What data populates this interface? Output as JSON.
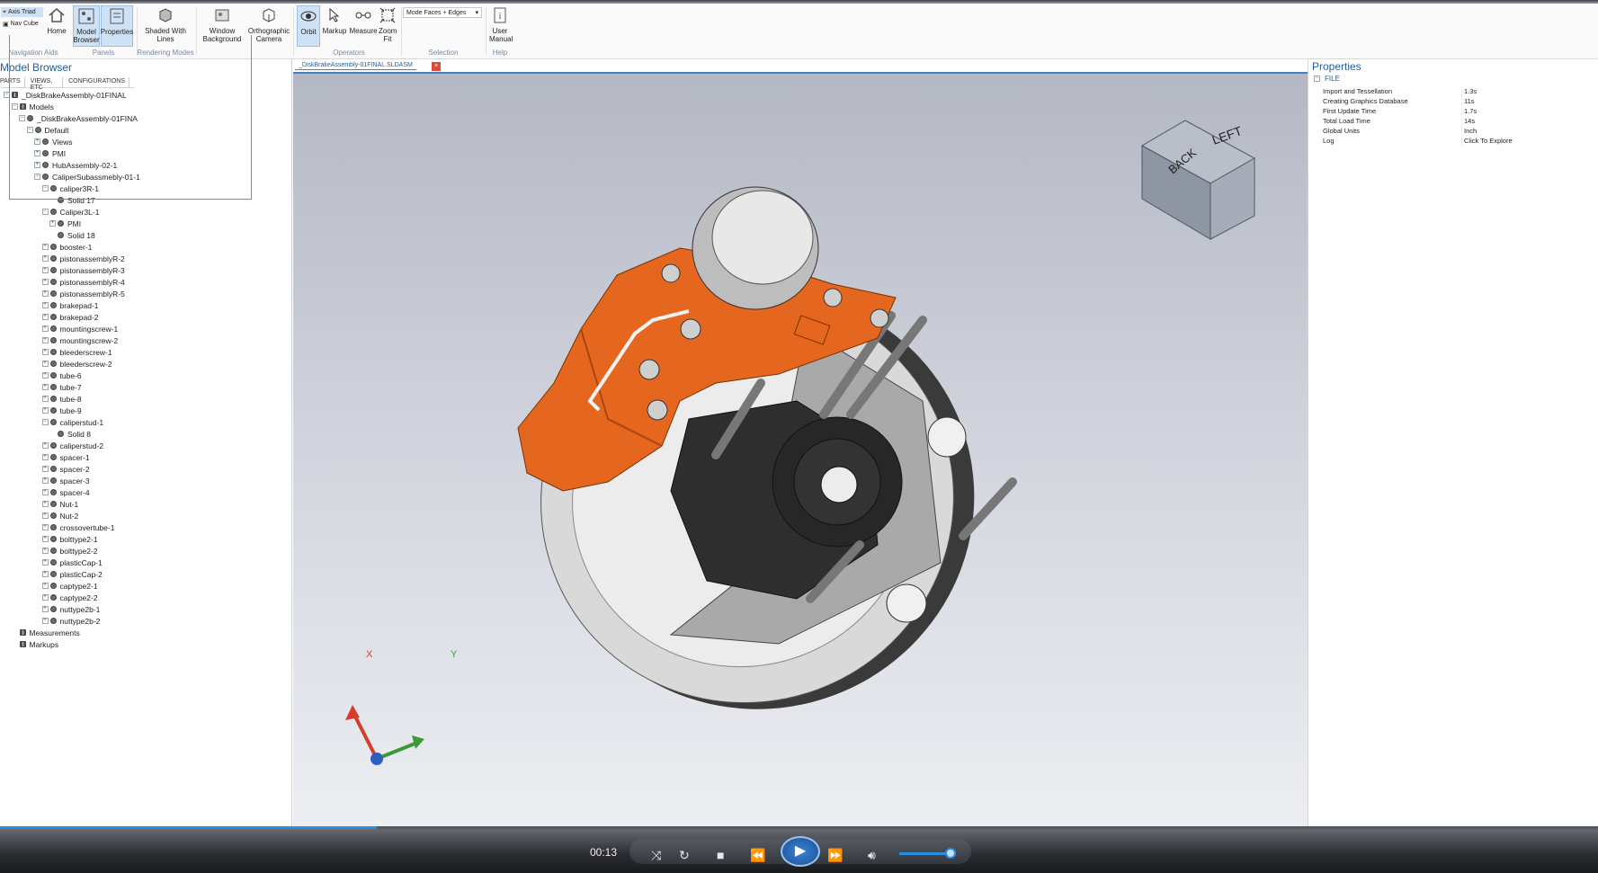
{
  "ribbon": {
    "axis_triad": "Axis Triad",
    "nav_cube": "Nav Cube",
    "home": "Home",
    "model_browser": "Model Browser",
    "properties": "Properties",
    "shaded_with_lines": "Shaded With Lines",
    "window_background": "Window Background",
    "orthographic_camera": "Orthographic Camera",
    "orbit": "Orbit",
    "markup": "Markup",
    "measure": "Measure",
    "zoom_fit": "Zoom Fit",
    "mode_dropdown": "Mode Faces + Edges",
    "user_manual": "User Manual",
    "groups": {
      "navigation_aids": "Navigation Aids",
      "panels": "Panels",
      "rendering_modes": "Rendering Modes",
      "operators": "Operators",
      "selection": "Selection",
      "help": "Help"
    }
  },
  "model_browser": {
    "title": "Model Browser",
    "tabs": [
      "PARTS",
      "VIEWS, ETC",
      "CONFIGURATIONS"
    ],
    "tree": [
      {
        "label": "_DiskBrakeAssembly-01FINAL",
        "depth": 0,
        "exp": "-"
      },
      {
        "label": "Models",
        "depth": 1,
        "exp": "-"
      },
      {
        "label": "_DiskBrakeAssembly-01FINA",
        "depth": 2,
        "exp": "-"
      },
      {
        "label": "Default",
        "depth": 3,
        "exp": "-"
      },
      {
        "label": "Views",
        "depth": 4,
        "exp": "+"
      },
      {
        "label": "PMI",
        "depth": 4,
        "exp": "+"
      },
      {
        "label": "HubAssembly-02-1",
        "depth": 4,
        "exp": "+"
      },
      {
        "label": "CaliperSubassmebly-01-1",
        "depth": 4,
        "exp": "-"
      },
      {
        "label": "caliper3R-1",
        "depth": 5,
        "exp": "-"
      },
      {
        "label": "Solid 17",
        "depth": 6,
        "exp": ""
      },
      {
        "label": "Caliper3L-1",
        "depth": 5,
        "exp": "-"
      },
      {
        "label": "PMI",
        "depth": 6,
        "exp": "+"
      },
      {
        "label": "Solid 18",
        "depth": 6,
        "exp": ""
      },
      {
        "label": "booster-1",
        "depth": 5,
        "exp": "+"
      },
      {
        "label": "pistonassemblyR-2",
        "depth": 5,
        "exp": "+"
      },
      {
        "label": "pistonassemblyR-3",
        "depth": 5,
        "exp": "+"
      },
      {
        "label": "pistonassemblyR-4",
        "depth": 5,
        "exp": "+"
      },
      {
        "label": "pistonassemblyR-5",
        "depth": 5,
        "exp": "+"
      },
      {
        "label": "brakepad-1",
        "depth": 5,
        "exp": "+"
      },
      {
        "label": "brakepad-2",
        "depth": 5,
        "exp": "+"
      },
      {
        "label": "mountingscrew-1",
        "depth": 5,
        "exp": "+"
      },
      {
        "label": "mountingscrew-2",
        "depth": 5,
        "exp": "+"
      },
      {
        "label": "bleederscrew-1",
        "depth": 5,
        "exp": "+"
      },
      {
        "label": "bleederscrew-2",
        "depth": 5,
        "exp": "+"
      },
      {
        "label": "tube-6",
        "depth": 5,
        "exp": "+"
      },
      {
        "label": "tube-7",
        "depth": 5,
        "exp": "+"
      },
      {
        "label": "tube-8",
        "depth": 5,
        "exp": "+"
      },
      {
        "label": "tube-9",
        "depth": 5,
        "exp": "+"
      },
      {
        "label": "caliperstud-1",
        "depth": 5,
        "exp": "-"
      },
      {
        "label": "Solid 8",
        "depth": 6,
        "exp": ""
      },
      {
        "label": "caliperstud-2",
        "depth": 5,
        "exp": "+"
      },
      {
        "label": "spacer-1",
        "depth": 5,
        "exp": "+"
      },
      {
        "label": "spacer-2",
        "depth": 5,
        "exp": "+"
      },
      {
        "label": "spacer-3",
        "depth": 5,
        "exp": "+"
      },
      {
        "label": "spacer-4",
        "depth": 5,
        "exp": "+"
      },
      {
        "label": "Nut-1",
        "depth": 5,
        "exp": "+"
      },
      {
        "label": "Nut-2",
        "depth": 5,
        "exp": "+"
      },
      {
        "label": "crossovertube-1",
        "depth": 5,
        "exp": "+"
      },
      {
        "label": "bolttype2-1",
        "depth": 5,
        "exp": "+"
      },
      {
        "label": "bolttype2-2",
        "depth": 5,
        "exp": "+"
      },
      {
        "label": "plasticCap-1",
        "depth": 5,
        "exp": "+"
      },
      {
        "label": "plasticCap-2",
        "depth": 5,
        "exp": "+"
      },
      {
        "label": "captype2-1",
        "depth": 5,
        "exp": "+"
      },
      {
        "label": "captype2-2",
        "depth": 5,
        "exp": "+"
      },
      {
        "label": "nuttype2b-1",
        "depth": 5,
        "exp": "+"
      },
      {
        "label": "nuttype2b-2",
        "depth": 5,
        "exp": "+"
      },
      {
        "label": "Measurements",
        "depth": 1,
        "exp": ""
      },
      {
        "label": "Markups",
        "depth": 1,
        "exp": ""
      }
    ]
  },
  "viewport": {
    "doc_tab": "_DiskBrakeAssembly-01FINAL.SLDASM",
    "navcube_back": "BACK",
    "navcube_left": "LEFT",
    "axis_x": "X",
    "axis_y": "Y"
  },
  "properties": {
    "title": "Properties",
    "section": "FILE",
    "rows": [
      {
        "key": "Import and Tessellation",
        "value": "1.3s"
      },
      {
        "key": "Creating Graphics Database",
        "value": "11s"
      },
      {
        "key": "First Update Time",
        "value": "1.7s"
      },
      {
        "key": "Total Load Time",
        "value": "14s"
      },
      {
        "key": "Global Units",
        "value": "Inch"
      },
      {
        "key": "Log",
        "value": "Click To Explore"
      }
    ]
  },
  "player": {
    "time": "00:13",
    "progress": 0.236,
    "volume": 0.85
  }
}
